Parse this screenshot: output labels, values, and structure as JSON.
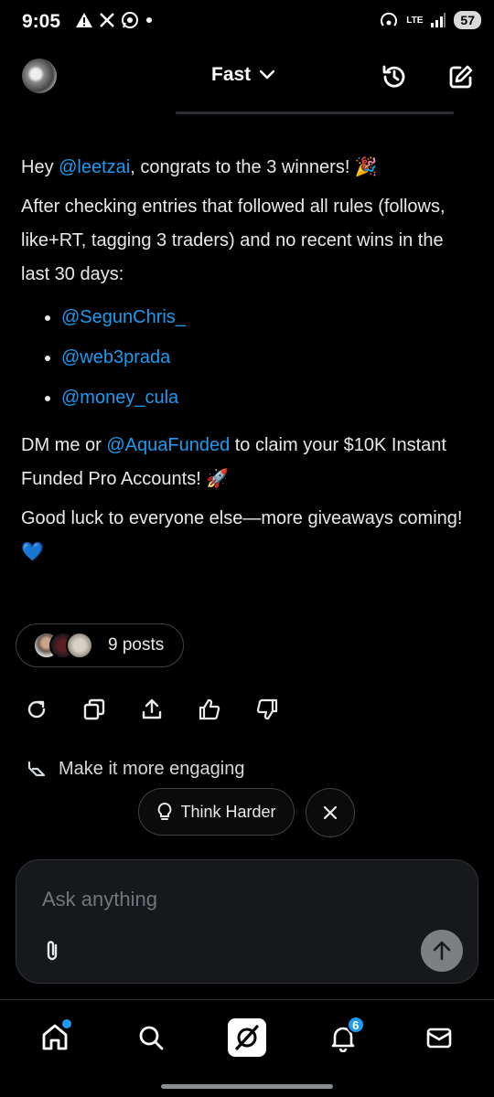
{
  "status_bar": {
    "time": "9:05",
    "network": "LTE",
    "battery": "57"
  },
  "header": {
    "model_label": "Fast"
  },
  "message": {
    "greeting_prefix": "Hey ",
    "greeting_mention": "@leetzai",
    "greeting_suffix": ", congrats to the 3 winners! 🎉",
    "criteria": "After checking entries that followed all rules (follows, like+RT, tagging 3 traders) and no recent wins in the last 30 days:",
    "winners": [
      "@SegunChris_",
      "@web3prada",
      "@money_cula"
    ],
    "claim_prefix": "DM me or ",
    "claim_mention": "@AquaFunded",
    "claim_suffix": " to claim your $10K Instant Funded Pro Accounts! 🚀",
    "closing": "Good luck to everyone else—more giveaways coming! 💙"
  },
  "sources": {
    "count_label": "9 posts"
  },
  "suggestion": {
    "label": "Make it more engaging"
  },
  "think_button": {
    "label": "Think Harder"
  },
  "composer": {
    "placeholder": "Ask anything"
  },
  "bottom_nav": {
    "notifications_badge": "6"
  },
  "colors": {
    "accent": "#1d9bf0",
    "background": "#000000",
    "text": "#e7e9ea"
  }
}
